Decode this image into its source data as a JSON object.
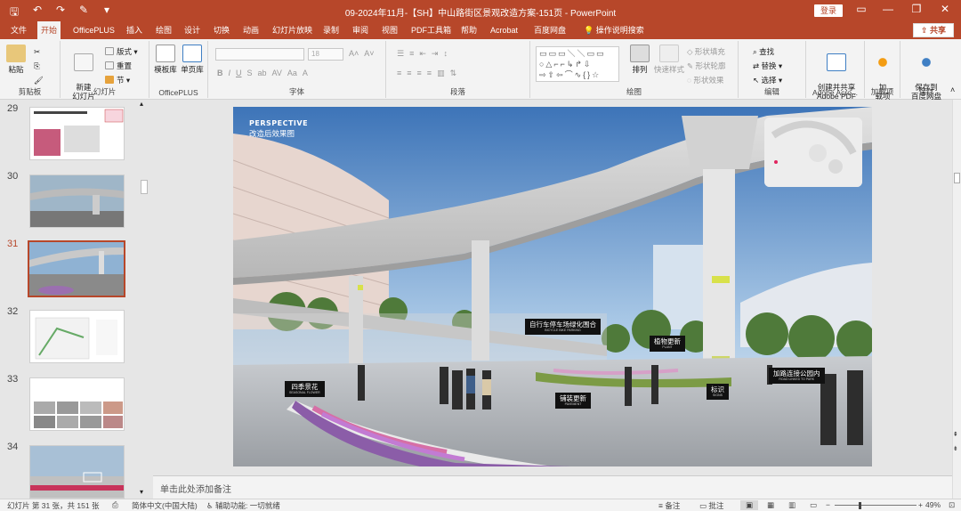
{
  "titlebar": {
    "title": "09-2024年11月-【SH】中山路街区景观改造方案-151页  -  PowerPoint",
    "login": "登录",
    "qat_icons": [
      "save-icon",
      "undo-icon",
      "redo-icon",
      "format-painter-icon",
      "dropdown-icon"
    ],
    "window_controls": {
      "ribbon_display": "▭",
      "minimize": "—",
      "restore": "❐",
      "close": "✕"
    }
  },
  "tabs": [
    {
      "label": "文件"
    },
    {
      "label": "开始"
    },
    {
      "label": "OfficePLUS"
    },
    {
      "label": "插入"
    },
    {
      "label": "绘图"
    },
    {
      "label": "设计"
    },
    {
      "label": "切换"
    },
    {
      "label": "动画"
    },
    {
      "label": "幻灯片放映"
    },
    {
      "label": "录制"
    },
    {
      "label": "审阅"
    },
    {
      "label": "视图"
    },
    {
      "label": "PDF工具箱"
    },
    {
      "label": "帮助"
    },
    {
      "label": "Acrobat"
    },
    {
      "label": "百度网盘"
    },
    {
      "label": "操作说明搜索"
    }
  ],
  "active_tab": "开始",
  "share_label": "共享",
  "ribbon": {
    "clipboard": {
      "label": "剪贴板",
      "paste": "粘贴"
    },
    "slides": {
      "label": "幻灯片",
      "new_slide": "新建\n幻灯片",
      "layout": "版式",
      "reset": "重置",
      "section": "节"
    },
    "officeplus": {
      "label": "OfficePLUS",
      "template": "模板库",
      "single_page": "单页库"
    },
    "font": {
      "label": "字体",
      "font_size": "18"
    },
    "paragraph": {
      "label": "段落"
    },
    "drawing": {
      "label": "绘图",
      "arrange": "排列",
      "quick_styles": "快速样式",
      "shape_fill": "形状填充",
      "shape_outline": "形状轮廓",
      "shape_effects": "形状效果"
    },
    "editing": {
      "label": "编辑",
      "find": "查找",
      "replace": "替换",
      "select": "选择"
    },
    "adobe": {
      "label": "Adobe Acro...",
      "create_share": "创建并共享\nAdobe PDF"
    },
    "addins": {
      "label": "加载项",
      "addin": "加\n载项"
    },
    "save": {
      "label": "保存",
      "save_baidu": "保存到\n百度网盘"
    }
  },
  "thumbnails": [
    {
      "num": "29",
      "active": false
    },
    {
      "num": "30",
      "active": false
    },
    {
      "num": "31",
      "active": true
    },
    {
      "num": "32",
      "active": false
    },
    {
      "num": "33",
      "active": false
    },
    {
      "num": "34",
      "active": false
    }
  ],
  "slide": {
    "perspective_title": "PERSPECTIVE",
    "perspective_subtitle": "改造后效果图",
    "callouts": [
      {
        "zh": "自行车停车场绿化围合",
        "en": "BICYCLE BIKE PARKING"
      },
      {
        "zh": "植物更新",
        "en": "PLANT"
      },
      {
        "zh": "四季景花",
        "en": "SEASONAL FLOWER"
      },
      {
        "zh": "铺装更新",
        "en": "PAVEMENT"
      },
      {
        "zh": "标识",
        "en": "SIGNS"
      },
      {
        "zh": "加路连接公园内",
        "en": "ROAD LINKED TO PARK"
      }
    ]
  },
  "notes_placeholder": "单击此处添加备注",
  "statusbar": {
    "slide_info": "幻灯片 第 31 张，共 151 张",
    "language": "简体中文(中国大陆)",
    "accessibility": "辅助功能: 一切就绪",
    "notes": "备注",
    "comments": "批注",
    "zoom": "49%"
  }
}
